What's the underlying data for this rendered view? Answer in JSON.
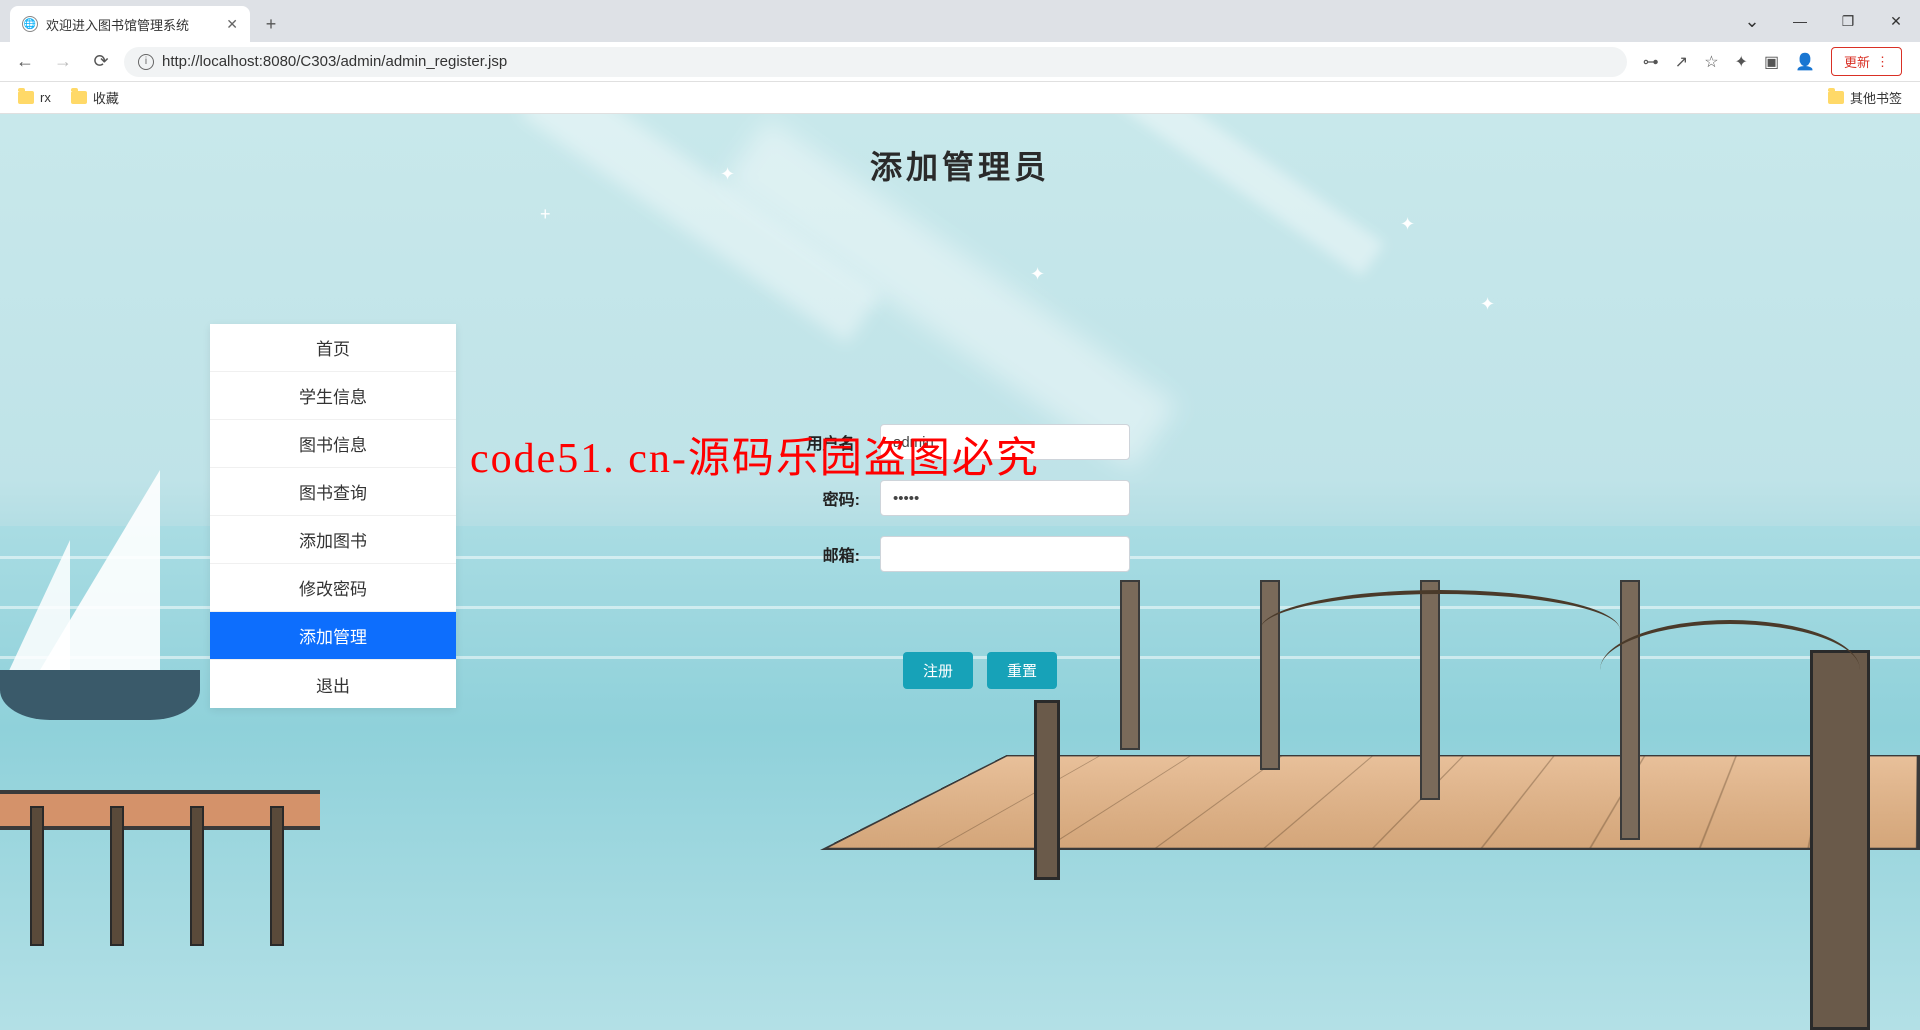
{
  "browser": {
    "tab_title": "欢迎进入图书馆管理系统",
    "new_tab": "+",
    "window": {
      "minimize": "—",
      "maximize": "❐",
      "close": "✕",
      "expand": "⌄"
    },
    "nav": {
      "back": "←",
      "forward": "→",
      "reload": "⟳"
    },
    "url": {
      "host": "localhost",
      "full": "http://localhost:8080/C303/admin/admin_register.jsp"
    },
    "toolbar_icons": {
      "key": "⊶",
      "share": "↗",
      "star": "☆",
      "ext": "✦",
      "panel": "▣",
      "profile": "👤"
    },
    "update_btn": "更新",
    "bookmarks": {
      "items": [
        "rx",
        "收藏"
      ],
      "other": "其他书签"
    }
  },
  "page": {
    "title": "添加管理员",
    "watermark": "code51. cn-源码乐园盗图必究"
  },
  "sidebar": {
    "items": [
      {
        "label": "首页"
      },
      {
        "label": "学生信息"
      },
      {
        "label": "图书信息"
      },
      {
        "label": "图书查询"
      },
      {
        "label": "添加图书"
      },
      {
        "label": "修改密码"
      },
      {
        "label": "添加管理"
      },
      {
        "label": "退出"
      }
    ],
    "active_index": 6
  },
  "form": {
    "username": {
      "label": "用户名:",
      "value": "admin"
    },
    "password": {
      "label": "密码:",
      "value": "•••••"
    },
    "email": {
      "label": "邮箱:",
      "value": ""
    },
    "submit": "注册",
    "reset": "重置"
  }
}
